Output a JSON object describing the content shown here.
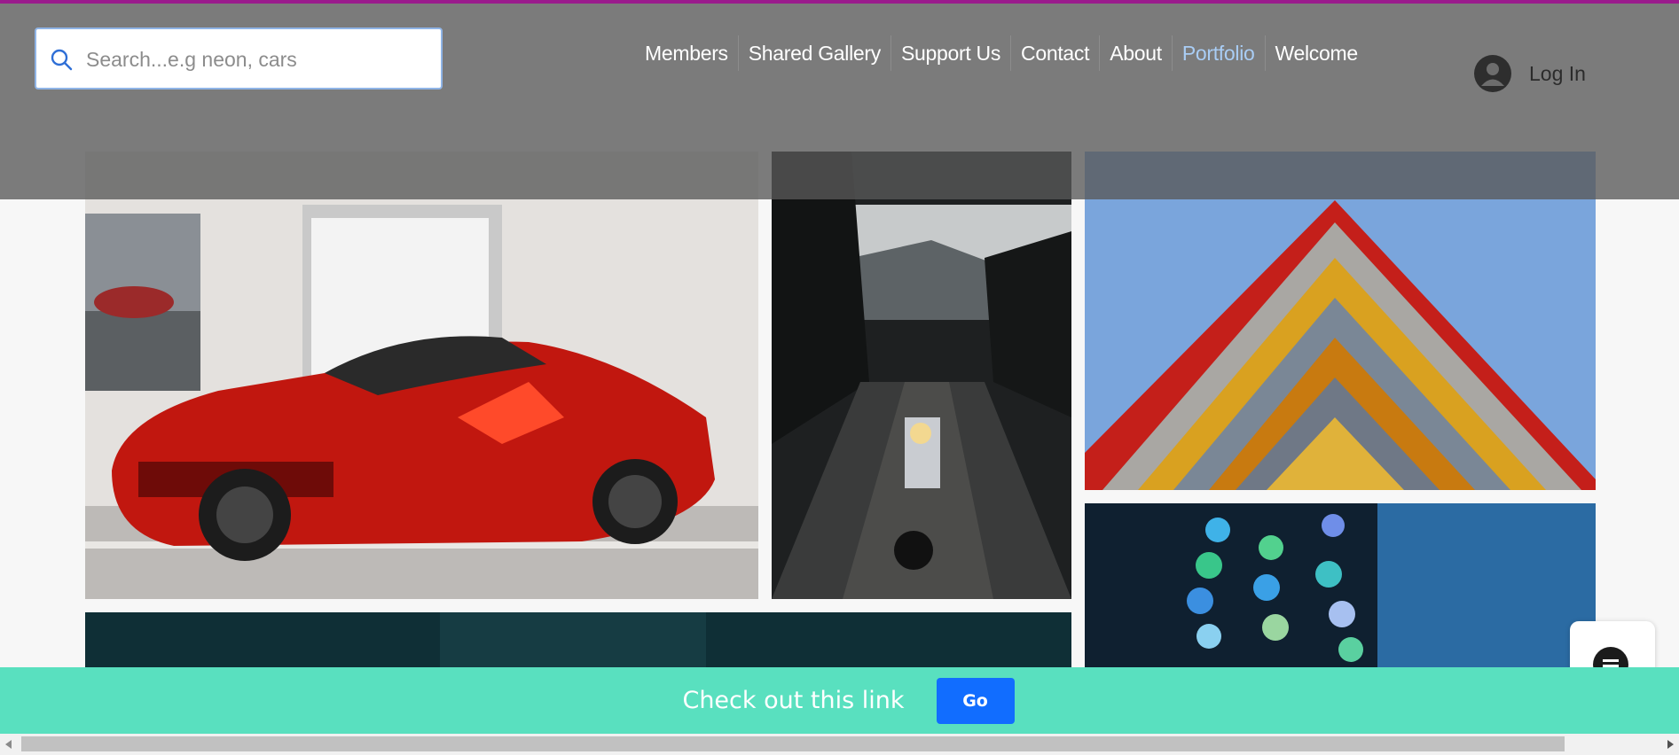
{
  "search": {
    "placeholder": "Search...e.g neon, cars",
    "icon": "search-icon"
  },
  "nav": {
    "items": [
      {
        "label": "Members"
      },
      {
        "label": "Shared Gallery"
      },
      {
        "label": "Support Us"
      },
      {
        "label": "Contact"
      },
      {
        "label": "About"
      },
      {
        "label": "Portfolio",
        "active": true
      },
      {
        "label": "Welcome"
      }
    ],
    "active_color": "#a9cdf5"
  },
  "login": {
    "label": "Log In",
    "icon": "user-avatar-icon"
  },
  "gallery": {
    "images": [
      {
        "subject": "red sports car in showroom"
      },
      {
        "subject": "motorcycle on forest road"
      },
      {
        "subject": "colorful building corner against blue sky"
      },
      {
        "subject": "blue bokeh lights"
      },
      {
        "subject": "dark teal image"
      }
    ]
  },
  "promo": {
    "text": "Check out this link",
    "button_label": "Go",
    "background": "#59e0bf",
    "button_color": "#116dff"
  },
  "accent": {
    "top_line": "#9a1a8c"
  }
}
